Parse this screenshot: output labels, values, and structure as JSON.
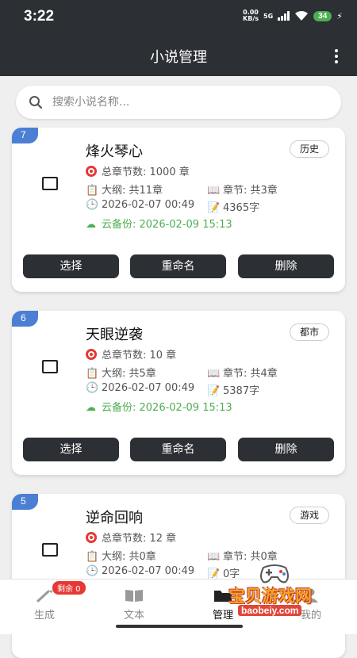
{
  "status": {
    "time": "3:22",
    "net_speed": "0.00",
    "net_unit": "KB/s",
    "signal": "5G",
    "battery": "34"
  },
  "app": {
    "title": "小说管理"
  },
  "search": {
    "placeholder": "搜索小说名称..."
  },
  "novels": [
    {
      "index": "7",
      "title": "烽火琴心",
      "genre": "历史",
      "chapters": "总章节数: 1000 章",
      "outline": "大纲: 共11章",
      "chapter_count": "章节: 共3章",
      "created": "2026-02-07 00:49",
      "words": "4365字",
      "backup": "云备份: 2026-02-09 15:13"
    },
    {
      "index": "6",
      "title": "天眼逆袭",
      "genre": "都市",
      "chapters": "总章节数: 10 章",
      "outline": "大纲: 共5章",
      "chapter_count": "章节: 共4章",
      "created": "2026-02-07 00:49",
      "words": "5387字",
      "backup": "云备份: 2026-02-09 15:13"
    },
    {
      "index": "5",
      "title": "逆命回响",
      "genre": "游戏",
      "chapters": "总章节数: 12 章",
      "outline": "大纲: 共0章",
      "chapter_count": "章节: 共0章",
      "created": "2026-02-07 00:49",
      "words": "0字",
      "backup": ""
    }
  ],
  "actions": {
    "select": "选择",
    "rename": "重命名",
    "delete": "删除"
  },
  "nav": {
    "generate": "生成",
    "text": "文本",
    "manage": "管理",
    "mine": "我的",
    "remaining_badge": "剩余 0"
  },
  "watermark": {
    "text": "宝贝游戏网",
    "url": "baobeiy.com"
  },
  "colors": {
    "header": "#2c2f33",
    "badge": "#4a7fd4",
    "backup": "#4caf50",
    "accent_red": "#e53935"
  }
}
